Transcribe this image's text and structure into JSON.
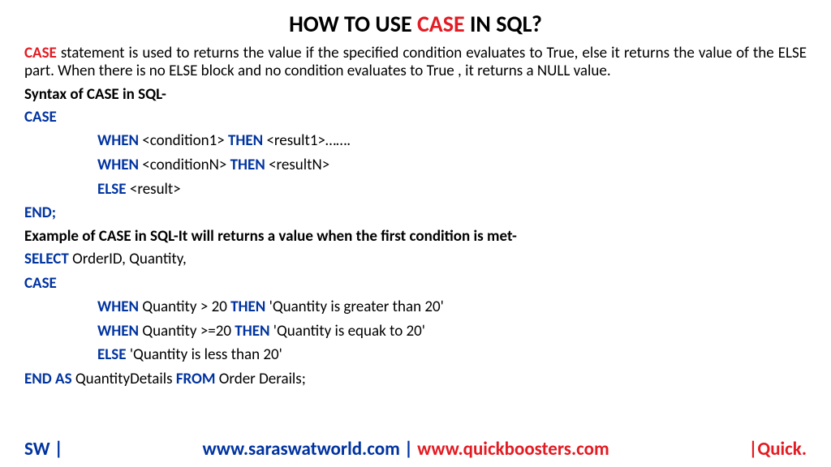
{
  "title_prefix": "HOW TO USE ",
  "title_keyword": "CASE",
  "title_suffix": " IN SQL?",
  "intro_keyword": "CASE",
  "intro_rest": " statement is used to returns the value if the specified condition evaluates to True, else it returns the  value of the ELSE part. When there is no ELSE block and no condition evaluates to True , it returns a NULL value.",
  "syntax_heading": "Syntax of CASE in SQL-",
  "kw_case": "CASE",
  "kw_when": "WHEN",
  "kw_then": "THEN",
  "kw_else": "ELSE",
  "kw_end": "END;",
  "kw_select": "SELECT",
  "kw_end_as": "END AS",
  "kw_from": "FROM",
  "syntax_cond1": " <condition1> ",
  "syntax_res1": " <result1>…….",
  "syntax_condN": " <conditionN> ",
  "syntax_resN": " <resultN>",
  "syntax_else_res": " <result>",
  "example_heading": "Example of CASE in SQL-It will returns a value when the first condition is met-",
  "select_cols": " OrderID, Quantity,",
  "ex_cond1": " Quantity > 20 ",
  "ex_res1": "  'Quantity is greater than 20'",
  "ex_cond2": " Quantity >=20 ",
  "ex_res2": "  'Quantity is equak to 20'",
  "ex_else_res": " 'Quantity is less than 20'",
  "end_as_val": " QuantityDetails ",
  "from_val": " Order Derails;",
  "footer_left": "SW |",
  "footer_center_blue": "www.saraswatworld.com | ",
  "footer_center_red": "www.quickboosters.com",
  "footer_right": "|Quick."
}
